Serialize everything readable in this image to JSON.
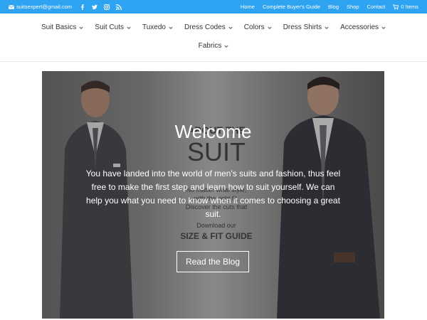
{
  "topbar": {
    "email": "suitsexpert@gmail.com",
    "social_icons": [
      "facebook-icon",
      "twitter-icon",
      "instagram-icon",
      "rss-icon"
    ],
    "links": [
      "Home",
      "Complete Buyer's Guide",
      "Blog",
      "Shop",
      "Contact"
    ],
    "cart_label": "0 Items"
  },
  "nav": {
    "row1": [
      "Suit Basics",
      "Suit Cuts",
      "Tuxedo",
      "Dress Codes",
      "Colors",
      "Dress Shirts",
      "Accessories"
    ],
    "row2": [
      "Fabrics"
    ]
  },
  "hero": {
    "title": "Welcome",
    "text": "You have landed into the world of men's suits and fashion, thus feel free to make the first step and learn how to suit yourself. We can help you what you need to know when it comes to choosing a great suit.",
    "button_label": "Read the Blog",
    "poster": {
      "headline1": "ABOUT THE",
      "headline2": "SUIT",
      "line1": "No matter what style,",
      "line2": "with the right fit.",
      "line3": "Discover the cuts that",
      "line4": "Download our",
      "guide": "SIZE & FIT GUIDE"
    }
  },
  "colors": {
    "topbar": "#2ea3f2",
    "nav_text": "#333333"
  }
}
